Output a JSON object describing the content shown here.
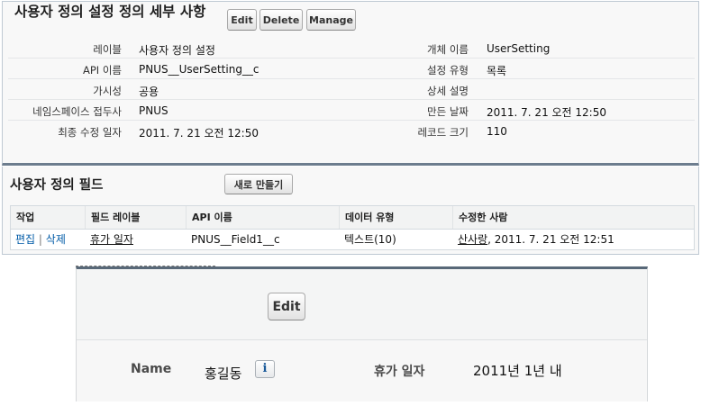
{
  "detail": {
    "title": "사용자 정의 설정 정의 세부 사항",
    "buttons": {
      "edit": "Edit",
      "delete": "Delete",
      "manage": "Manage"
    },
    "fields_left": [
      {
        "label": "레이블",
        "value": "사용자 정의 설정"
      },
      {
        "label": "API 이름",
        "value": "PNUS__UserSetting__c"
      },
      {
        "label": "가시성",
        "value": "공용"
      },
      {
        "label": "네임스페이스 접두사",
        "value": "PNUS"
      },
      {
        "label": "최종 수정 일자",
        "value": "2011. 7. 21 오전 12:50"
      }
    ],
    "fields_right": [
      {
        "label": "개체 이름",
        "value": "UserSetting"
      },
      {
        "label": "설정 유형",
        "value": "목록"
      },
      {
        "label": "상세 설명",
        "value": ""
      },
      {
        "label": "만든 날짜",
        "value": "2011. 7. 21 오전 12:50"
      },
      {
        "label": "레코드 크기",
        "value": "110"
      }
    ]
  },
  "custom_fields": {
    "title": "사용자 정의 필드",
    "new_button": "새로 만들기",
    "columns": [
      "작업",
      "필드 레이블",
      "API 이름",
      "데이터 유형",
      "수정한 사람"
    ],
    "rows": [
      {
        "action_edit": "편집",
        "action_sep": "|",
        "action_delete": "삭제",
        "field_label": "휴가 일자",
        "api_name": "PNUS__Field1__c",
        "data_type": "텍스트(10)",
        "modified_by": "산사랑",
        "modified_at": ", 2011. 7. 21 오전 12:51"
      }
    ]
  },
  "record": {
    "edit_button": "Edit",
    "name_label": "Name",
    "name_value": "홍길동",
    "info_icon": "i",
    "vacation_label": "휴가 일자",
    "vacation_value": "2011년 1년 내"
  }
}
